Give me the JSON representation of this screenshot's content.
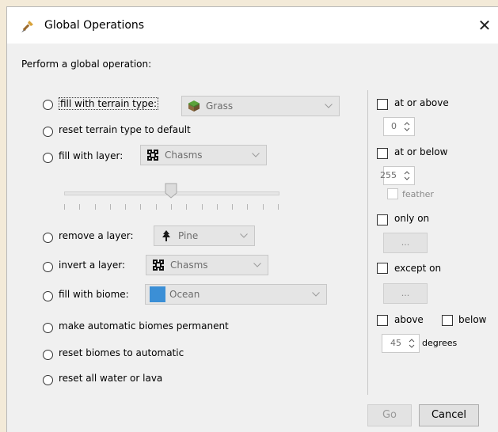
{
  "window": {
    "title": "Global Operations",
    "close_label": "✕"
  },
  "heading": "Perform a global operation:",
  "options": {
    "fill_terrain": {
      "label": "fill with terrain type:",
      "value": "Grass"
    },
    "reset_terrain": {
      "label": "reset terrain type to default"
    },
    "fill_layer": {
      "label": "fill with layer:",
      "value": "Chasms"
    },
    "remove_layer": {
      "label": "remove a layer:",
      "value": "Pine"
    },
    "invert_layer": {
      "label": "invert a layer:",
      "value": "Chasms"
    },
    "fill_biome": {
      "label": "fill with biome:",
      "value": "Ocean"
    },
    "make_biomes_permanent": {
      "label": "make automatic biomes permanent"
    },
    "reset_biomes": {
      "label": "reset biomes to automatic"
    },
    "reset_water": {
      "label": "reset all water or lava"
    }
  },
  "filters": {
    "at_or_above": {
      "label": "at or above",
      "value": "0"
    },
    "at_or_below": {
      "label": "at or below",
      "value": "255"
    },
    "feather": {
      "label": "feather"
    },
    "only_on": {
      "label": "only on",
      "button": "..."
    },
    "except_on": {
      "label": "except on",
      "button": "..."
    },
    "above": {
      "label": "above"
    },
    "below": {
      "label": "below"
    },
    "degrees": {
      "value": "45",
      "label": "degrees"
    }
  },
  "slider": {
    "level": 0.5,
    "tick_count": 15
  },
  "buttons": {
    "go": "Go",
    "cancel": "Cancel"
  },
  "colors": {
    "ocean": "#3b8fd6",
    "grass_top": "#5aa33a",
    "grass_side": "#8a6a3f",
    "pine": "#1a1a1a"
  },
  "icons": {
    "app": "shovel-icon",
    "terrain": "grass-block-icon",
    "layer": "chasms-icon",
    "pine": "pine-tree-icon"
  }
}
